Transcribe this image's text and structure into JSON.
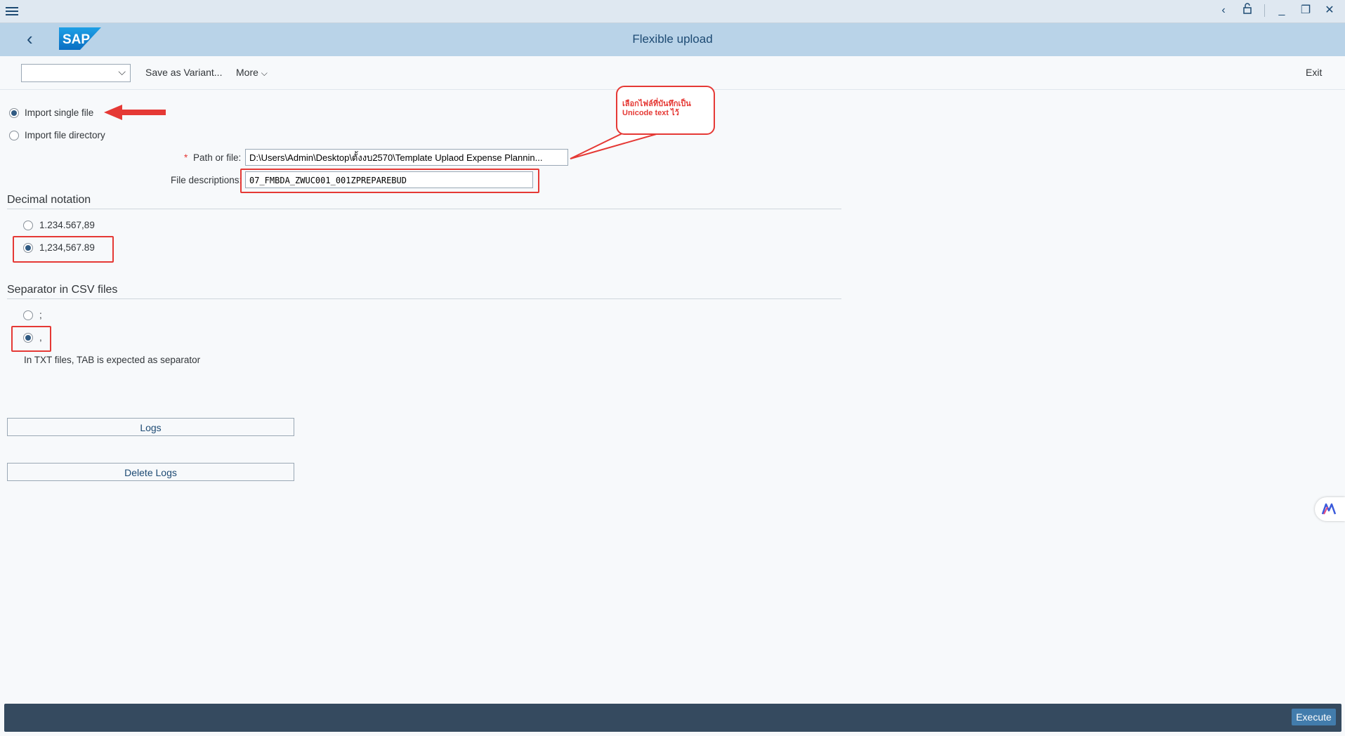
{
  "window": {
    "title": "Flexible upload"
  },
  "toolbar": {
    "save_variant_label": "Save as Variant...",
    "more_label": "More",
    "exit_label": "Exit",
    "variant_value": ""
  },
  "import_options": [
    {
      "label": "Import single file",
      "selected": true
    },
    {
      "label": "Import file directory",
      "selected": false
    }
  ],
  "fields": {
    "path_required_mark": "*",
    "path_label": "Path or file:",
    "path_value": "D:\\Users\\Admin\\Desktop\\ตั้งงบ2570\\Template Uplaod  Expense Plannin...",
    "desc_label": "File descriptions:",
    "desc_value": "07_FMBDA_ZWUC001_001ZPREPAREBUD"
  },
  "decimal_notation": {
    "title": "Decimal notation",
    "options": [
      {
        "label": "1.234.567,89",
        "selected": false
      },
      {
        "label": "1,234,567.89",
        "selected": true
      }
    ]
  },
  "csv_separator": {
    "title": "Separator in CSV files",
    "options": [
      {
        "label": ";",
        "selected": false
      },
      {
        "label": ",",
        "selected": true
      }
    ],
    "hint": "In TXT files, TAB is expected as separator"
  },
  "buttons": {
    "logs": "Logs",
    "delete_logs": "Delete Logs",
    "execute": "Execute"
  },
  "annotation": {
    "text": "เลือกไฟล์ที่บันทึกเป็น Unicode text ไว้"
  },
  "colors": {
    "shell": "#b9d3e8",
    "accent": "#427cac",
    "annotation_red": "#e53935",
    "footer": "#354a5f"
  }
}
